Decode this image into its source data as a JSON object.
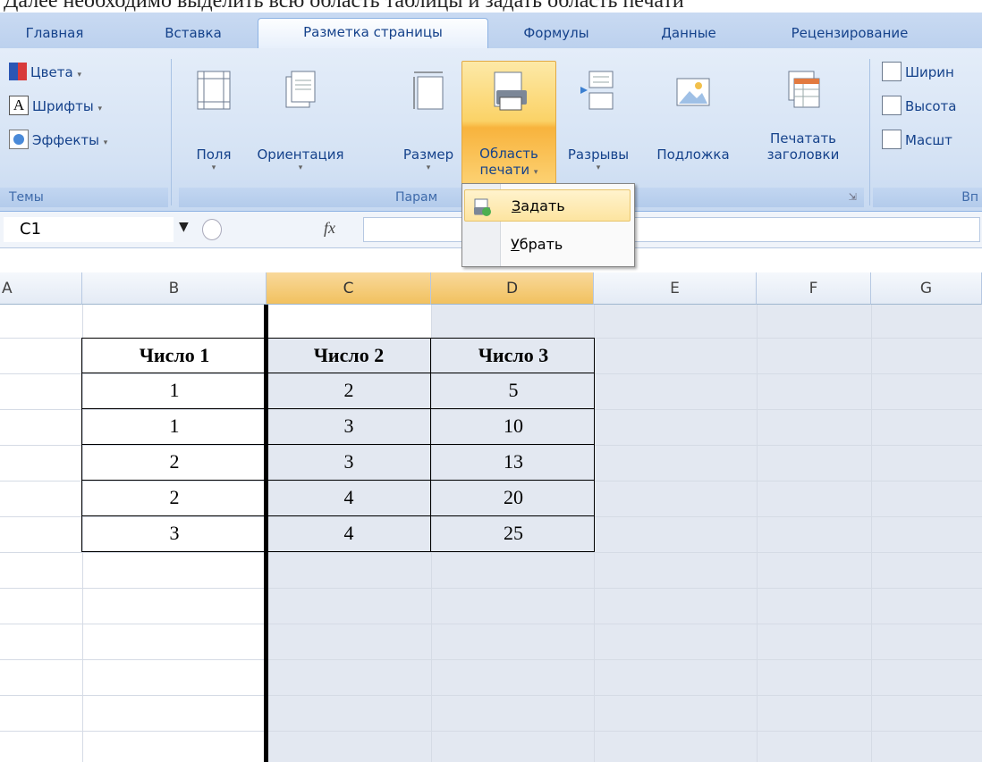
{
  "top_text": "Далее необходимо выделить всю область таблицы и задать область печати",
  "tabs": [
    "Главная",
    "Вставка",
    "Разметка страницы",
    "Формулы",
    "Данные",
    "Рецензирование"
  ],
  "ribbon": {
    "themes": {
      "colors": "Цвета",
      "fonts": "Шрифты",
      "effects": "Эффекты",
      "label": "Темы"
    },
    "page_setup": {
      "margins": "Поля",
      "orientation": "Ориентация",
      "size": "Размер",
      "print_area_1": "Область",
      "print_area_2": "печати",
      "breaks": "Разрывы",
      "background": "Подложка",
      "print_titles_1": "Печатать",
      "print_titles_2": "заголовки",
      "label": "Парам"
    },
    "scale": {
      "width": "Ширин",
      "height": "Высота",
      "scale": "Масшт",
      "label": "Вп"
    }
  },
  "dropdown": {
    "set": "Задать",
    "set_accel": "З",
    "set_rest": "адать",
    "clear_accel": "У",
    "clear_rest": "брать"
  },
  "formula_bar": {
    "name_box": "C1",
    "fx": "fx"
  },
  "columns": [
    "A",
    "B",
    "C",
    "D",
    "E",
    "F",
    "G"
  ],
  "selected_column": "C",
  "table": {
    "headers": [
      "Число 1",
      "Число 2",
      "Число 3"
    ],
    "rows": [
      [
        "1",
        "2",
        "5"
      ],
      [
        "1",
        "3",
        "10"
      ],
      [
        "2",
        "3",
        "13"
      ],
      [
        "2",
        "4",
        "20"
      ],
      [
        "3",
        "4",
        "25"
      ]
    ]
  }
}
